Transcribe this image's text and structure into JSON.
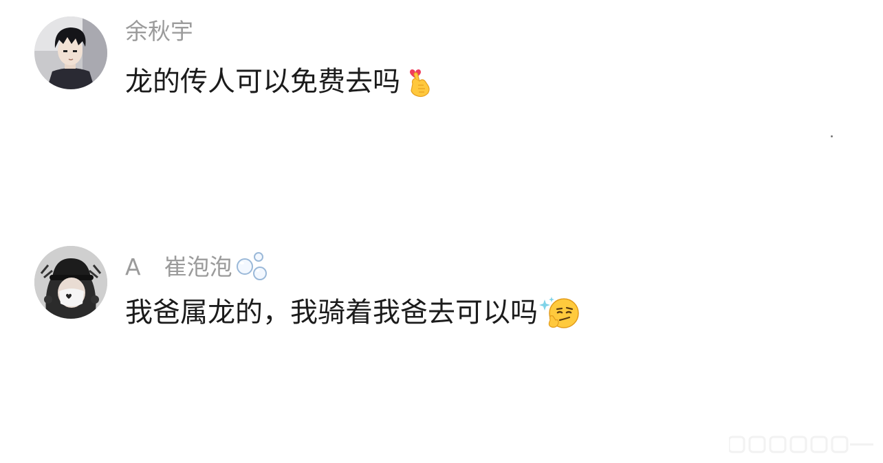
{
  "comments": [
    {
      "username": "余秋宇",
      "message": "龙的传人可以免费去吗",
      "avatar_icon": "anime-boy-avatar-icon",
      "emoji_icon": "finger-heart-emoji-icon"
    },
    {
      "username_prefix": "A",
      "username": "崔泡泡",
      "username_emoji_icon": "bubbles-emoji-icon",
      "message": "我爸属龙的，我骑着我爸去可以吗",
      "avatar_icon": "masked-girl-avatar-icon",
      "emoji_icon": "smirk-thinking-emoji-icon"
    }
  ],
  "colors": {
    "username": "#9b9b9b",
    "message": "#1b1b1b",
    "background": "#ffffff"
  }
}
